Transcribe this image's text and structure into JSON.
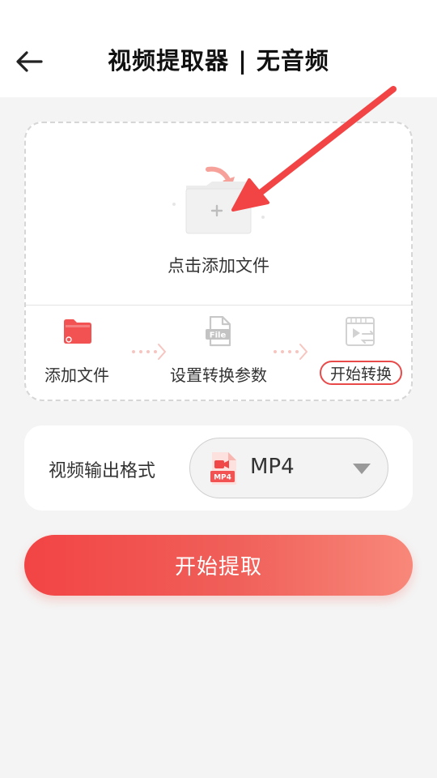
{
  "header": {
    "title": "视频提取器 | 无音频",
    "back_icon": "back-arrow-icon"
  },
  "upload": {
    "drop_label": "点击添加文件",
    "drop_icon": "add-folder-icon",
    "steps": [
      {
        "label": "添加文件",
        "icon": "folder-icon",
        "state": "done"
      },
      {
        "label": "设置转换参数",
        "icon": "file-icon",
        "state": "pending"
      },
      {
        "label": "开始转换",
        "icon": "video-convert-icon",
        "state": "pending"
      }
    ],
    "file_badge": "File"
  },
  "format": {
    "label": "视频输出格式",
    "selected": "MP4",
    "badge": "MP4",
    "icon": "mp4-file-icon"
  },
  "actions": {
    "start_label": "开始提取"
  },
  "annotation": {
    "icon": "pointer-arrow-icon"
  },
  "colors": {
    "accent": "#f24444",
    "accent_light": "#f8887a",
    "step_done": "#f25252",
    "step_pending": "#cccccc",
    "background": "#f4f4f4"
  }
}
